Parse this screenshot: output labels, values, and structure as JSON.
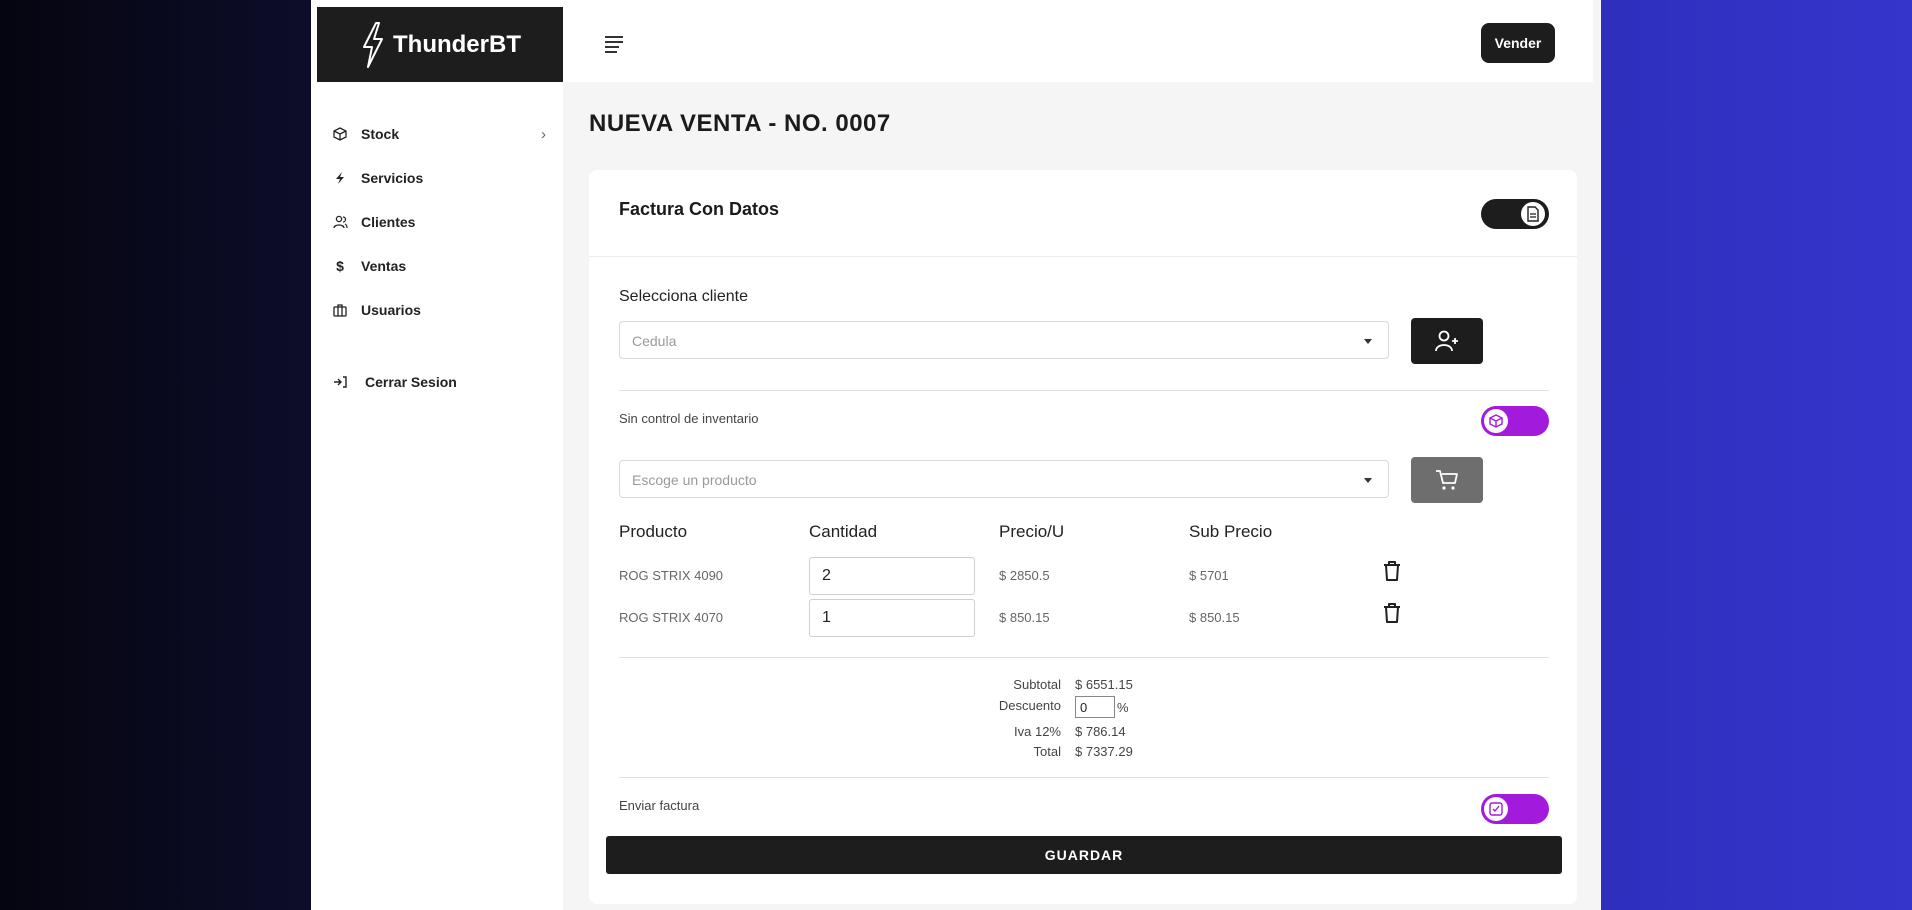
{
  "app": {
    "brand": "ThunderBT"
  },
  "sidebar": {
    "items": [
      {
        "label": "Stock",
        "icon": "cube-icon",
        "chevron": "›"
      },
      {
        "label": "Servicios",
        "icon": "bolt-icon"
      },
      {
        "label": "Clientes",
        "icon": "users-icon"
      },
      {
        "label": "Ventas",
        "icon": "dollar-icon"
      },
      {
        "label": "Usuarios",
        "icon": "briefcase-icon"
      }
    ],
    "logout": {
      "label": "Cerrar Sesion",
      "icon": "logout-icon"
    }
  },
  "header": {
    "vender_label": "Vender"
  },
  "page": {
    "title": "NUEVA VENTA - NO. 0007"
  },
  "card": {
    "title": "Factura Con Datos",
    "cliente_label": "Selecciona cliente",
    "cliente_placeholder": "Cedula",
    "inventario_label": "Sin control de inventario",
    "producto_placeholder": "Escoge un producto",
    "columns": [
      "Producto",
      "Cantidad",
      "Precio/U",
      "Sub Precio"
    ],
    "rows": [
      {
        "producto": "ROG STRIX 4090",
        "cantidad": "2",
        "precio": "$ 2850.5",
        "sub": "$ 5701"
      },
      {
        "producto": "ROG STRIX 4070",
        "cantidad": "1",
        "precio": "$ 850.15",
        "sub": "$ 850.15"
      }
    ],
    "totals": {
      "subtotal_label": "Subtotal",
      "subtotal": "$ 6551.15",
      "descuento_label": "Descuento",
      "descuento": "0",
      "descuento_unit": "%",
      "iva_label": "Iva 12%",
      "iva": "$ 786.14",
      "total_label": "Total",
      "total": "$ 7337.29"
    },
    "enviar_label": "Enviar factura",
    "save_label": "GUARDAR"
  },
  "colors": {
    "dark": "#1d1d1d",
    "accent_purple": "#a21bdc",
    "gray_button": "#6e6e6e"
  }
}
